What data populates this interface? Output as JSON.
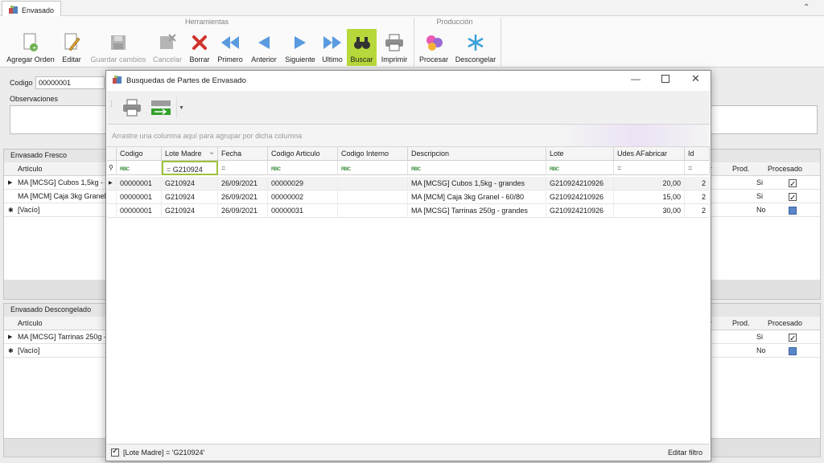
{
  "tab": {
    "label": "Envasado",
    "icon": "envasado-icon"
  },
  "ribbon": {
    "group_herramientas": "Herramientas",
    "group_produccion": "Producción",
    "buttons": {
      "agregar": "Agregar Orden",
      "editar": "Editar",
      "guardar": "Guardar cambios",
      "cancelar": "Cancelar",
      "borrar": "Borrar",
      "primero": "Primero",
      "anterior": "Anterior",
      "siguiente": "Siguiente",
      "ultimo": "Ultimo",
      "buscar": "Buscar",
      "imprimir": "Imprimir",
      "procesar": "Procesar",
      "descongelar": "Descongelar"
    }
  },
  "form": {
    "codigo_label": "Codigo",
    "codigo_value": "00000001",
    "observaciones_label": "Observaciones"
  },
  "fresco": {
    "title": "Envasado Fresco",
    "col_articulo": "Artículo",
    "col_r": "r",
    "col_prod": "Prod.",
    "col_procesado": "Procesado",
    "rows": [
      {
        "articulo": "MA [MCSG] Cubos 1,5kg - gr",
        "prod": "Si"
      },
      {
        "articulo": "MA [MCM] Caja 3kg Granel -",
        "prod": "Si"
      },
      {
        "articulo": "[Vacío]",
        "prod": "No"
      }
    ]
  },
  "descongelado": {
    "title": "Envasado Descongelado",
    "col_articulo": "Artículo",
    "col_r": "r",
    "col_prod": "Prod.",
    "col_procesado": "Procesado",
    "rows": [
      {
        "articulo": "MA [MCSG] Tarrinas 250g - g",
        "prod": "Si"
      },
      {
        "articulo": "[Vacío]",
        "prod": "No"
      }
    ]
  },
  "dialog": {
    "title": "Busquedas de Partes de Envasado",
    "group_hint": "Arrastre una columna aquí para agrupar por dicha columna",
    "columns": [
      "Codigo",
      "Lote Madre",
      "Fecha",
      "Codigo Articulo",
      "Codigo Interno",
      "Descripcion",
      "Lote",
      "Udes AFabricar",
      "Id"
    ],
    "filter_lote_madre": "G210924",
    "filter_eq": "=",
    "filter_rbc": "RBC",
    "rows": [
      [
        "00000001",
        "G210924",
        "26/09/2021",
        "00000029",
        "",
        "MA [MCSG] Cubos 1,5kg - grandes",
        "G210924210926",
        "20,00",
        "2"
      ],
      [
        "00000001",
        "G210924",
        "26/09/2021",
        "00000002",
        "",
        "MA [MCM] Caja 3kg Granel - 60/80",
        "G210924210926",
        "15,00",
        "2"
      ],
      [
        "00000001",
        "G210924",
        "26/09/2021",
        "00000031",
        "",
        "MA [MCSG] Tarrinas 250g - grandes",
        "G210924210926",
        "30,00",
        "2"
      ]
    ],
    "filter_text": "[Lote Madre] = 'G210924'",
    "edit_filter": "Editar filtro"
  },
  "colors": {
    "accent": "#b7d83a",
    "selected_filter_border": "#9cc33a"
  }
}
